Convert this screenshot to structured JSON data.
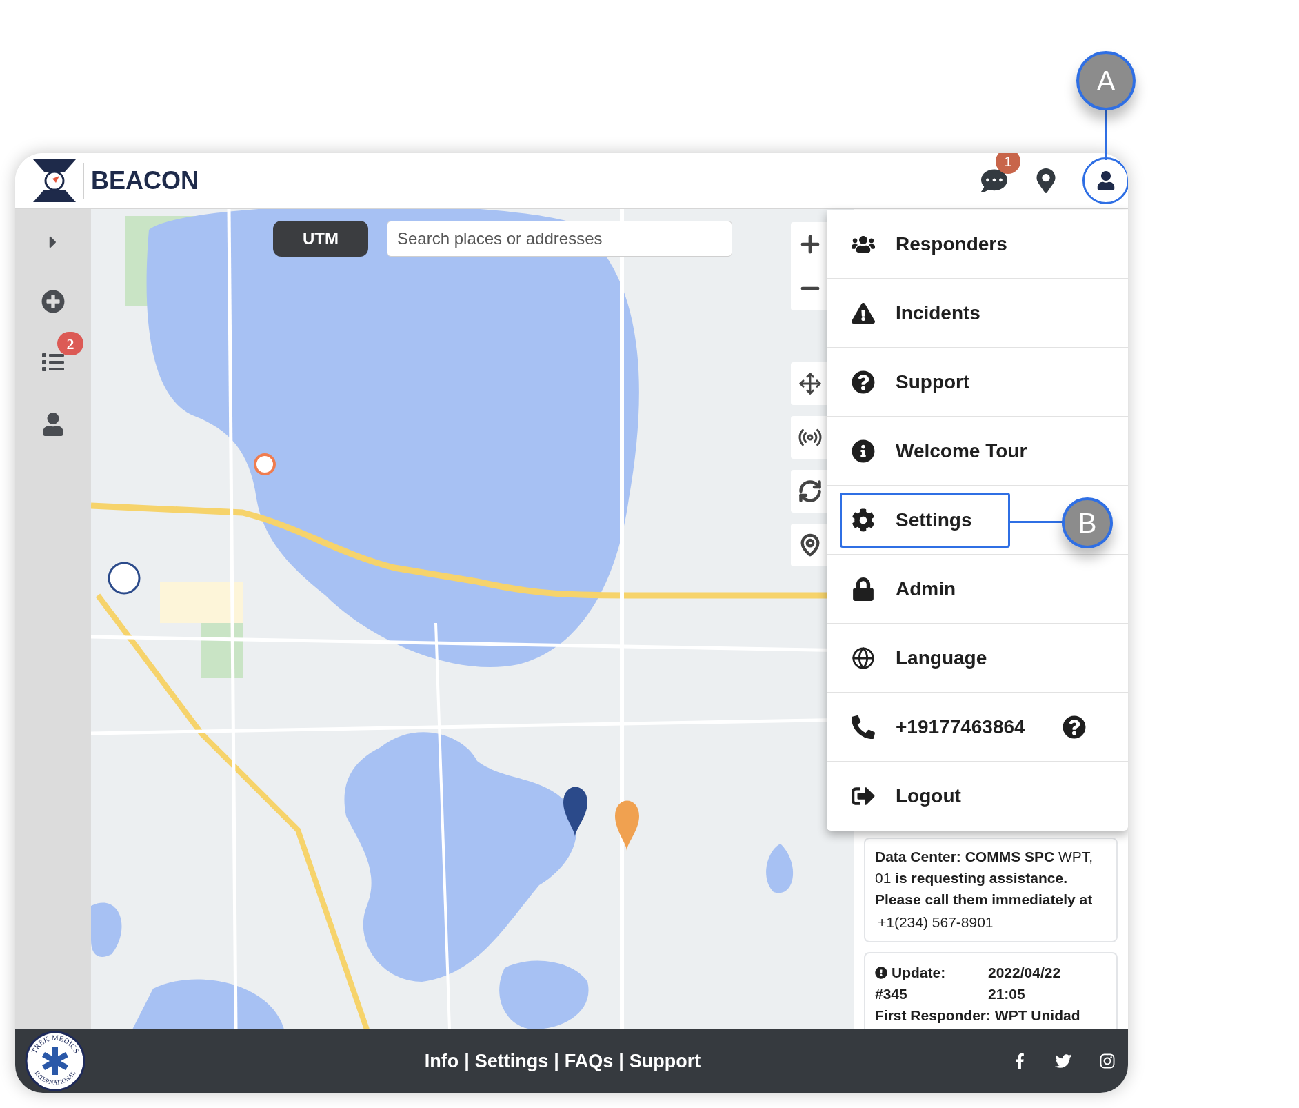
{
  "header": {
    "brand": "BEACON",
    "chat_badge": "1"
  },
  "sidebar": {
    "list_badge": "2"
  },
  "map": {
    "mode_button": "UTM",
    "search": {
      "placeholder": "Search places or addresses"
    }
  },
  "menu": {
    "items": [
      {
        "kind": "link",
        "label": "Responders",
        "selected": false
      },
      {
        "kind": "link",
        "label": "Incidents",
        "selected": false
      },
      {
        "kind": "link",
        "label": "Support",
        "selected": false
      },
      {
        "kind": "link",
        "label": "Welcome Tour",
        "selected": false
      },
      {
        "kind": "link",
        "label": "Settings",
        "selected": true
      },
      {
        "kind": "link",
        "label": "Admin",
        "selected": false
      },
      {
        "kind": "link",
        "label": "Language",
        "selected": false
      },
      {
        "kind": "phone",
        "label": "+19177463864",
        "selected": false
      },
      {
        "kind": "link",
        "label": "Logout",
        "selected": false
      }
    ]
  },
  "alerts": [
    {
      "kind": "request",
      "message": "**Data Center: COMMS SPC** WPT, 01 **is requesting assistance. Please call them immediately at**",
      "phone": "+1(234) 567-8901"
    },
    {
      "kind": "update",
      "label": "Update:",
      "number": "#345",
      "date": "2022/04/22",
      "time": "21:05",
      "responder": "First Responder: WPT Unidad"
    }
  ],
  "footer": {
    "logo_top": "TREK MEDICS",
    "logo_bottom": "INTERNATIONAL",
    "links": [
      "Info",
      "Settings",
      "FAQs",
      "Support"
    ],
    "separator": "|"
  },
  "callouts": [
    {
      "label": "A"
    },
    {
      "label": "B"
    }
  ]
}
